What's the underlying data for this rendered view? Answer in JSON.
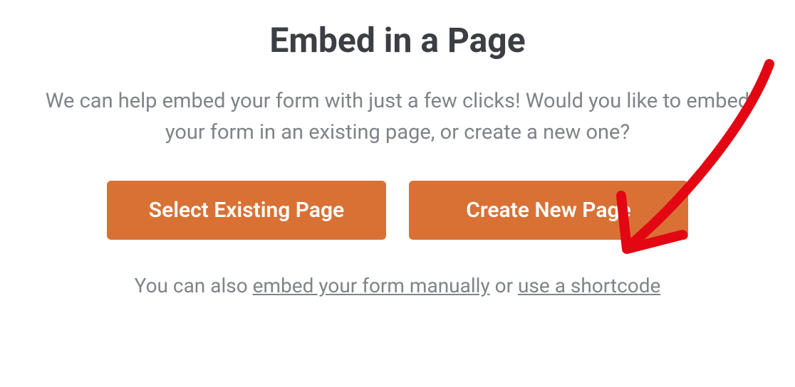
{
  "title": "Embed in a Page",
  "description": "We can help embed your form with just a few clicks! Would you like to embed your form in an existing page, or create a new one?",
  "buttons": {
    "select_existing": "Select Existing Page",
    "create_new": "Create New Page"
  },
  "footer": {
    "prefix": "You can also ",
    "link_manual": "embed your form manually",
    "middle": " or ",
    "link_shortcode": "use a shortcode"
  },
  "annotation": {
    "arrow_color": "#e30613"
  }
}
